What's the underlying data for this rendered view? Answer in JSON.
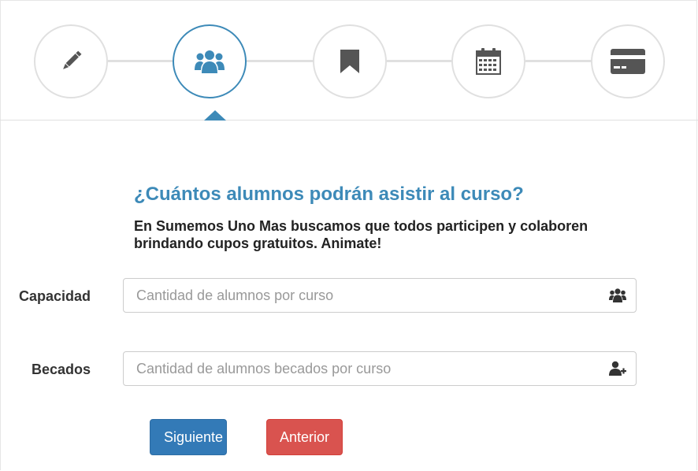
{
  "wizard": {
    "steps": [
      {
        "name": "pencil-icon",
        "active": false
      },
      {
        "name": "users-icon",
        "active": true
      },
      {
        "name": "bookmark-icon",
        "active": false
      },
      {
        "name": "calendar-icon",
        "active": false
      },
      {
        "name": "credit-card-icon",
        "active": false
      }
    ],
    "active_color": "#3d8ab8",
    "inactive_border_color": "#e0e0e0"
  },
  "question": {
    "title": "¿Cuántos alumnos podrán asistir al curso?",
    "description": "En Sumemos Uno Mas buscamos que todos participen y colaboren brindando cupos gratuitos. Animate!"
  },
  "form": {
    "capacity": {
      "label": "Capacidad",
      "placeholder": "Cantidad de alumnos por curso",
      "value": "",
      "icon": "users-icon"
    },
    "scholarships": {
      "label": "Becados",
      "placeholder": "Cantidad de alumnos becados por curso",
      "value": "",
      "icon": "user-plus-icon"
    }
  },
  "buttons": {
    "next_label": "Siguiente",
    "previous_label": "Anterior",
    "next_color": "#337ab7",
    "previous_color": "#d9534f"
  }
}
